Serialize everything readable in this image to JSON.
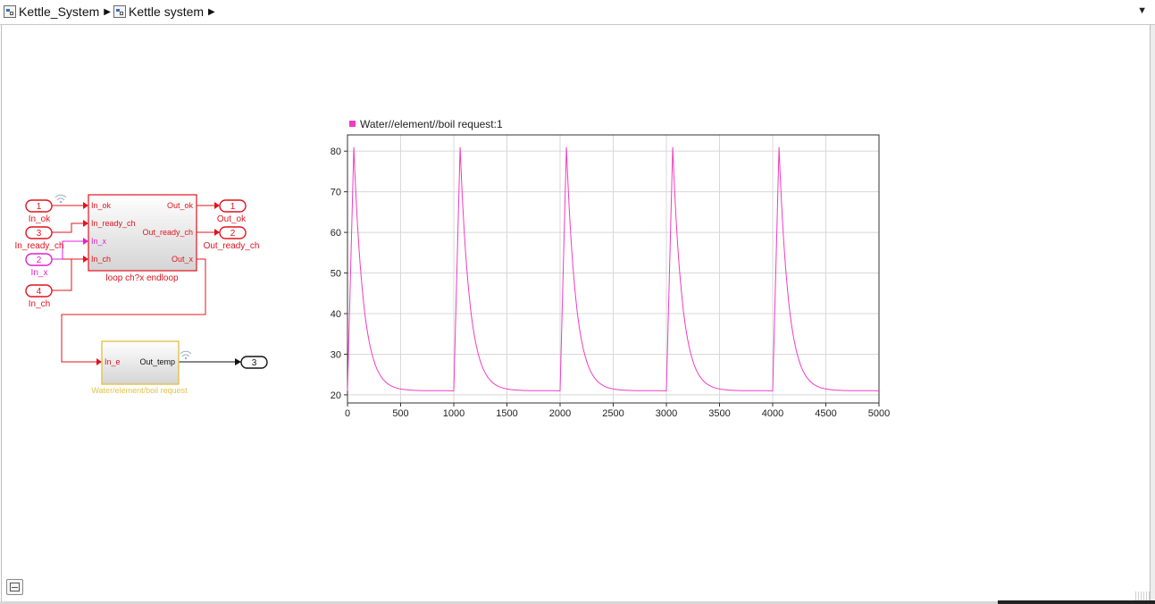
{
  "breadcrumb": {
    "items": [
      {
        "label": "Kettle_System"
      },
      {
        "label": "Kettle system"
      }
    ]
  },
  "colors": {
    "signal_red": "#e0141e",
    "signal_magenta": "#e020d0",
    "subsystem_yellow": "#e2c24a",
    "trace_pink": "#f03cc2"
  },
  "diagram": {
    "inports": [
      {
        "num": "1",
        "name": "In_ok"
      },
      {
        "num": "3",
        "name": "In_ready_ch"
      },
      {
        "num": "2",
        "name": "In_x"
      },
      {
        "num": "4",
        "name": "In_ch"
      }
    ],
    "loop_block": {
      "name": "loop ch?x endloop",
      "inputs": [
        "In_ok",
        "In_ready_ch",
        "In_x",
        "In_ch"
      ],
      "outputs": [
        "Out_ok",
        "Out_ready_ch",
        "Out_x"
      ]
    },
    "outports": [
      {
        "num": "1",
        "name": "Out_ok"
      },
      {
        "num": "2",
        "name": "Out_ready_ch"
      }
    ],
    "water_block": {
      "name": "Water/element/boil request",
      "input": "In_e",
      "output": "Out_temp"
    },
    "final_outport": {
      "num": "3"
    }
  },
  "chart_data": {
    "type": "line",
    "legend": "Water//element//boil request:1",
    "xlim": [
      0,
      5000
    ],
    "ylim": [
      18,
      84
    ],
    "xticks": [
      "0",
      "500",
      "1000",
      "1500",
      "2000",
      "2500",
      "3000",
      "3500",
      "4000",
      "4500",
      "5000"
    ],
    "yticks": [
      "20",
      "30",
      "40",
      "50",
      "60",
      "70",
      "80"
    ],
    "grid": true,
    "series": [
      {
        "peaks_x": [
          60,
          1060,
          2060,
          3060,
          4060
        ],
        "peak_y": 81,
        "base_y": 21
      }
    ]
  }
}
